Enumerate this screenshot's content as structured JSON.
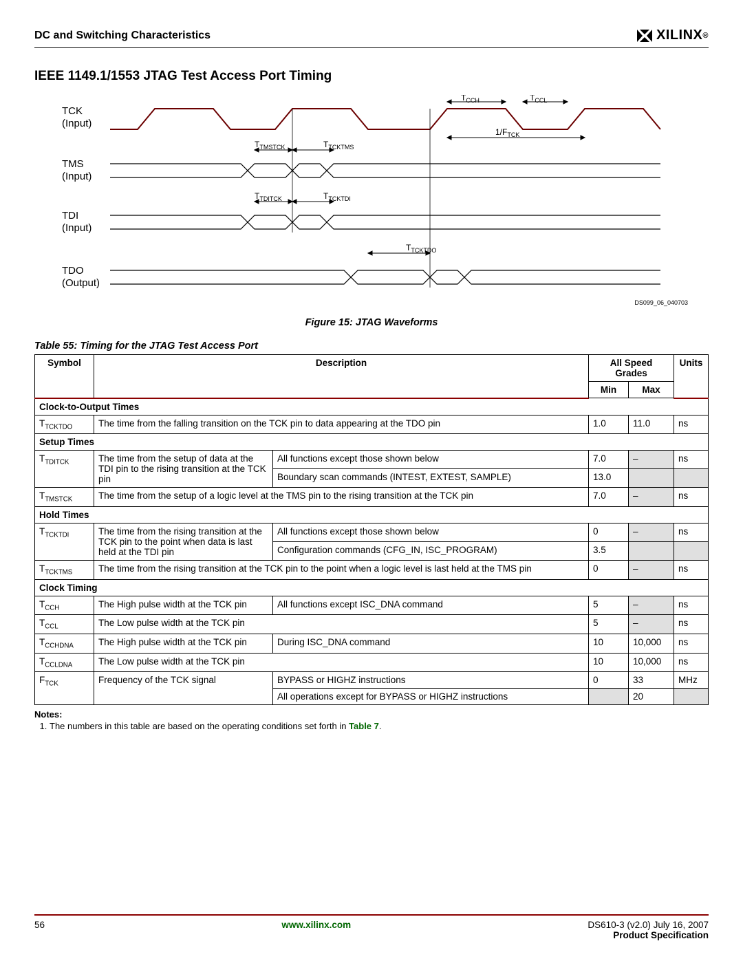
{
  "header": {
    "section": "DC and Switching Characteristics",
    "logo_text": "XILINX"
  },
  "title": "IEEE 1149.1/1553 JTAG Test Access Port Timing",
  "figure": {
    "signals": {
      "tck": "TCK",
      "tck_sub": "(Input)",
      "tms": "TMS",
      "tms_sub": "(Input)",
      "tdi": "TDI",
      "tdi_sub": "(Input)",
      "tdo": "TDO",
      "tdo_sub": "(Output)"
    },
    "annot": {
      "tcch": "T",
      "tcch_sub": "CCH",
      "tccl": "T",
      "tccl_sub": "CCL",
      "ftck": "1/F",
      "ftck_sub": "TCK",
      "ttmstck": "T",
      "ttmstck_sub": "TMSTCK",
      "ttcktms": "T",
      "ttcktms_sub": "TCKTMS",
      "ttditck": "T",
      "ttditck_sub": "TDITCK",
      "ttcktdi": "T",
      "ttcktdi_sub": "TCKTDI",
      "ttcktdo": "T",
      "ttcktdo_sub": "TCKTDO"
    },
    "ds_id": "DS099_06_040703",
    "caption_prefix": "Figure 15:  ",
    "caption": "JTAG Waveforms"
  },
  "table": {
    "caption_prefix": "Table  55:  ",
    "caption": "Timing for the JTAG Test Access Port",
    "head": {
      "allspeed": "All Speed Grades",
      "symbol": "Symbol",
      "description": "Description",
      "min": "Min",
      "max": "Max",
      "units": "Units"
    },
    "sections": {
      "s1": "Clock-to-Output Times",
      "s2": "Setup Times",
      "s3": "Hold Times",
      "s4": "Clock Timing"
    },
    "rows": {
      "r1": {
        "sym": "T",
        "sub": "TCKTDO",
        "desc": "The time from the falling transition on the TCK pin to data appearing at the TDO pin",
        "min": "1.0",
        "max": "11.0",
        "units": "ns"
      },
      "r2": {
        "sym": "T",
        "sub": "TDITCK",
        "desc": "The time from the setup of data at the TDI pin to the rising transition at the TCK pin",
        "cond1": "All functions except those shown below",
        "min1": "7.0",
        "max1": "–",
        "units": "ns",
        "cond2": "Boundary scan commands (INTEST, EXTEST, SAMPLE)",
        "min2": "13.0"
      },
      "r3": {
        "sym": "T",
        "sub": "TMSTCK",
        "desc": "The time from the setup of a logic level at the TMS pin to the rising transition at the TCK pin",
        "min": "7.0",
        "max": "–",
        "units": "ns"
      },
      "r4": {
        "sym": "T",
        "sub": "TCKTDI",
        "desc": "The time from the rising transition at the TCK pin to the point when data is last held at the TDI pin",
        "cond1": "All functions except those shown below",
        "min1": "0",
        "max1": "–",
        "units": "ns",
        "cond2": "Configuration commands (CFG_IN, ISC_PROGRAM)",
        "min2": "3.5"
      },
      "r5": {
        "sym": "T",
        "sub": "TCKTMS",
        "desc": "The time from the rising transition at the TCK pin to the point when a logic level is last held at the TMS pin",
        "min": "0",
        "max": "–",
        "units": "ns"
      },
      "r6": {
        "sym": "T",
        "sub": "CCH",
        "desc": "The High pulse width at the TCK pin",
        "cond": "All functions except ISC_DNA command",
        "min": "5",
        "max": "–",
        "units": "ns"
      },
      "r7": {
        "sym": "T",
        "sub": "CCL",
        "desc": "The Low pulse width at the TCK pin",
        "min": "5",
        "max": "–",
        "units": "ns"
      },
      "r8": {
        "sym": "T",
        "sub": "CCHDNA",
        "desc": "The High pulse width at the TCK pin",
        "cond": "During ISC_DNA command",
        "min": "10",
        "max": "10,000",
        "units": "ns"
      },
      "r9": {
        "sym": "T",
        "sub": "CCLDNA",
        "desc": "The Low pulse width at the TCK pin",
        "min": "10",
        "max": "10,000",
        "units": "ns"
      },
      "r10": {
        "sym": "F",
        "sub": "TCK",
        "desc": "Frequency of the TCK signal",
        "cond1": "BYPASS or HIGHZ instructions",
        "min1": "0",
        "max1": "33",
        "units": "MHz",
        "cond2": "All operations except for BYPASS or HIGHZ instructions",
        "max2": "20"
      }
    },
    "notes_heading": "Notes:",
    "note1_a": "The numbers in this table are based on the operating conditions set forth in ",
    "note1_link": "Table 7",
    "note1_b": "."
  },
  "footer": {
    "page": "56",
    "link": "www.xilinx.com",
    "doc": "DS610-3 (v2.0) July 16, 2007",
    "spec": "Product Specification"
  }
}
